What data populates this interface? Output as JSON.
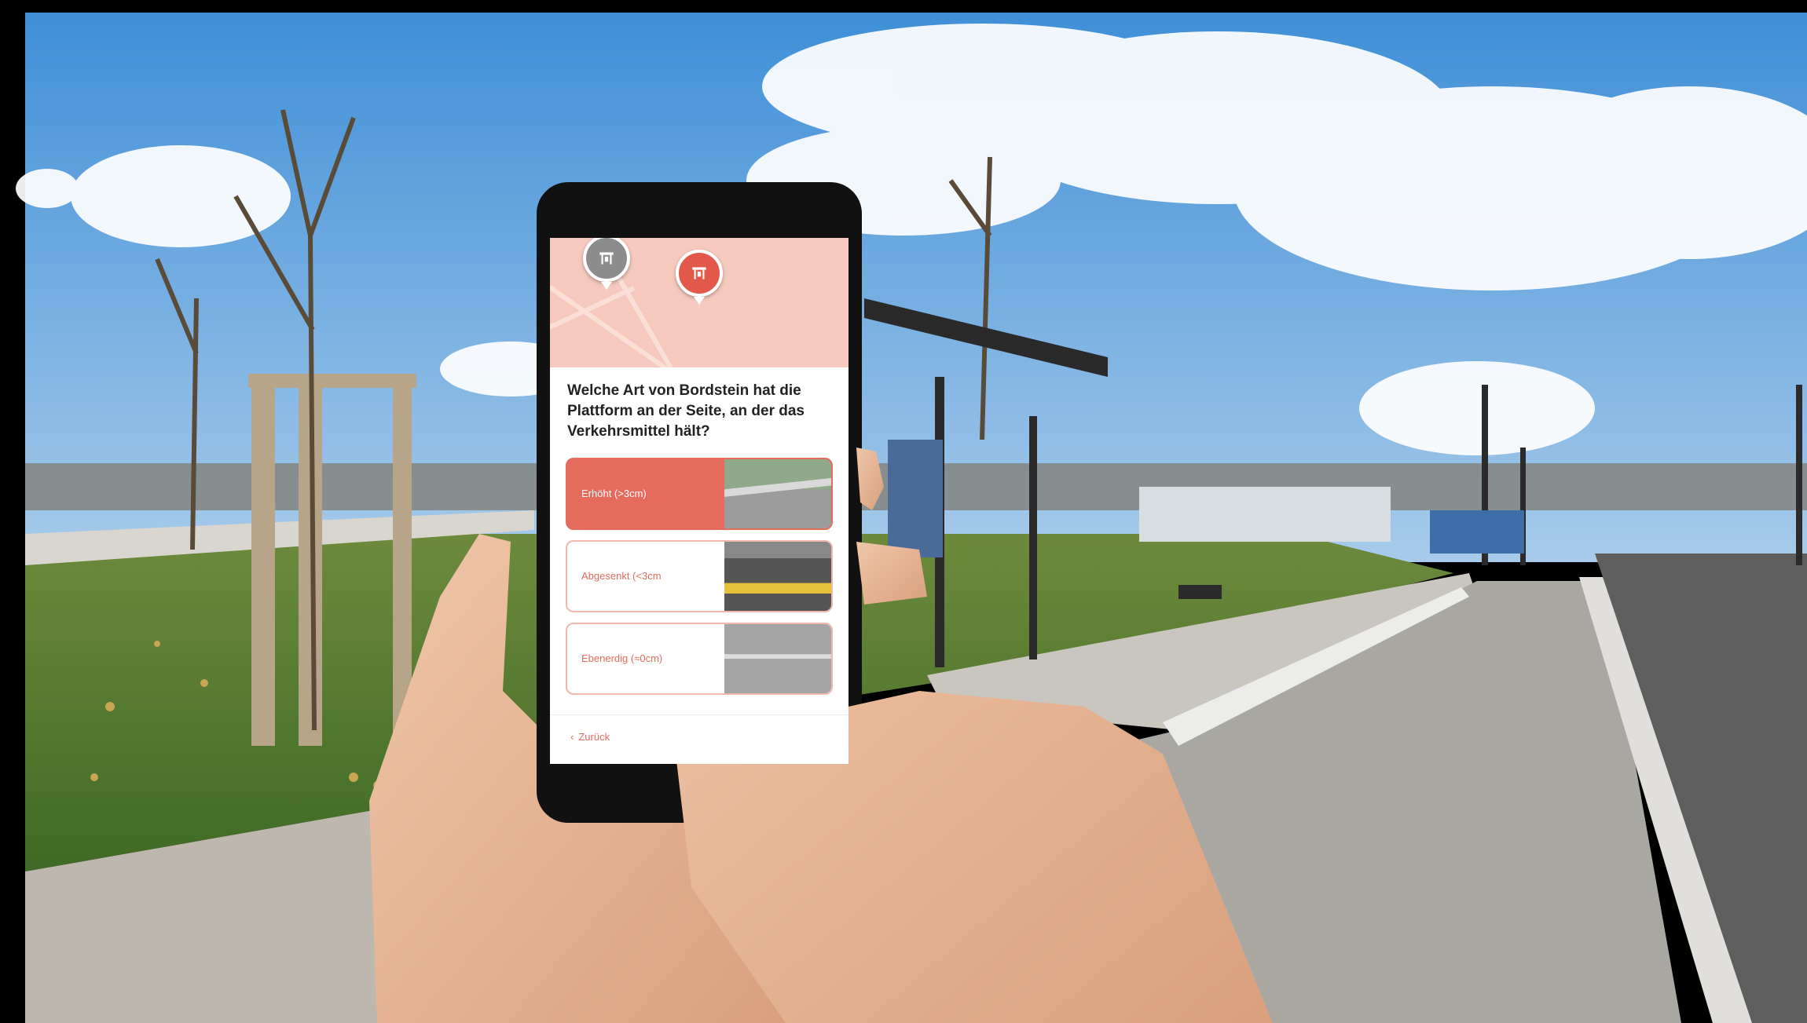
{
  "photo": {
    "description_icon": "bus-stop-scene"
  },
  "app": {
    "question": "Welche Art von Bordstein hat die Plattform an der Seite, an der das Verkehrsmittel hält?",
    "options": [
      {
        "label": "Erhöht (>3cm)",
        "selected": true
      },
      {
        "label": "Abgesenkt (<3cm",
        "selected": false
      },
      {
        "label": "Ebenerdig (≈0cm)",
        "selected": false
      }
    ],
    "back_label": "Zurück",
    "accent_color": "#e56b5d"
  }
}
